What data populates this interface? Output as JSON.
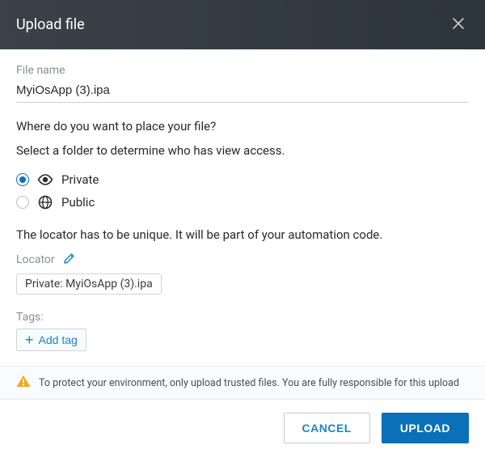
{
  "dialog": {
    "title": "Upload file"
  },
  "file": {
    "label": "File name",
    "value": "MyiOsApp (3).ipa"
  },
  "placement": {
    "question": "Where do you want to place your file?",
    "instruction": "Select a folder to determine who has view access.",
    "options": {
      "private": "Private",
      "public": "Public"
    }
  },
  "locator": {
    "note": "The locator has to be unique. It will be part of your automation code.",
    "label": "Locator",
    "value": "Private: MyiOsApp (3).ipa"
  },
  "tags": {
    "label": "Tags:",
    "add_label": "Add tag"
  },
  "warning": {
    "text": "To protect your environment, only upload trusted files. You are fully responsible for this upload"
  },
  "buttons": {
    "cancel": "CANCEL",
    "upload": "UPLOAD"
  }
}
